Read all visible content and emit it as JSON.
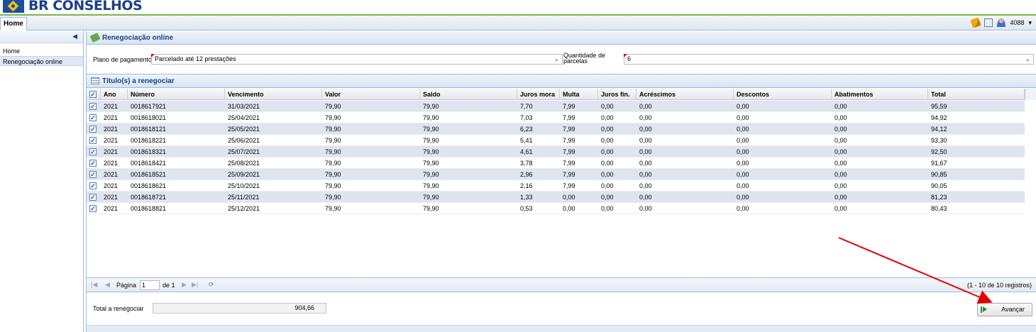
{
  "header": {
    "logo_text": "BR CONSELHOS",
    "tab_home": "Home",
    "user_code": "4088",
    "icons": [
      "pencil-icon",
      "picture-icon",
      "user-icon",
      "chevron-down-icon"
    ]
  },
  "sidebar": {
    "collapse_glyph": "◀",
    "items": [
      {
        "label": "Home"
      },
      {
        "label": "Renegociação online"
      }
    ]
  },
  "panel": {
    "title": "Renegociação online"
  },
  "form": {
    "plan_label": "Plano de pagamento",
    "plan_value": "Parcelado até 12 prestações",
    "qty_label_1": "Quantidade de",
    "qty_label_2": "parcelas",
    "qty_value": "6"
  },
  "grid": {
    "title": "Título(s) a renegociar",
    "columns": [
      "Ano",
      "Número",
      "Vencimento",
      "Valor",
      "Saldo",
      "Juros mora",
      "Multa",
      "Juros fin.",
      "Acréscimos",
      "Descontos",
      "Abatimentos",
      "Total"
    ],
    "rows": [
      {
        "ano": "2021",
        "numero": "0018617921",
        "vencimento": "31/03/2021",
        "valor": "79,90",
        "saldo": "79,90",
        "juros_mora": "7,70",
        "multa": "7,99",
        "juros_fin": "0,00",
        "acrescimos": "0,00",
        "descontos": "0,00",
        "abatimentos": "0,00",
        "total": "95,59"
      },
      {
        "ano": "2021",
        "numero": "0018618021",
        "vencimento": "25/04/2021",
        "valor": "79,90",
        "saldo": "79,90",
        "juros_mora": "7,03",
        "multa": "7,99",
        "juros_fin": "0,00",
        "acrescimos": "0,00",
        "descontos": "0,00",
        "abatimentos": "0,00",
        "total": "94,92"
      },
      {
        "ano": "2021",
        "numero": "0018618121",
        "vencimento": "25/05/2021",
        "valor": "79,90",
        "saldo": "79,90",
        "juros_mora": "6,23",
        "multa": "7,99",
        "juros_fin": "0,00",
        "acrescimos": "0,00",
        "descontos": "0,00",
        "abatimentos": "0,00",
        "total": "94,12"
      },
      {
        "ano": "2021",
        "numero": "0018618221",
        "vencimento": "25/06/2021",
        "valor": "79,90",
        "saldo": "79,90",
        "juros_mora": "5,41",
        "multa": "7,99",
        "juros_fin": "0,00",
        "acrescimos": "0,00",
        "descontos": "0,00",
        "abatimentos": "0,00",
        "total": "93,30"
      },
      {
        "ano": "2021",
        "numero": "0018618321",
        "vencimento": "25/07/2021",
        "valor": "79,90",
        "saldo": "79,90",
        "juros_mora": "4,61",
        "multa": "7,99",
        "juros_fin": "0,00",
        "acrescimos": "0,00",
        "descontos": "0,00",
        "abatimentos": "0,00",
        "total": "92,50"
      },
      {
        "ano": "2021",
        "numero": "0018618421",
        "vencimento": "25/08/2021",
        "valor": "79,90",
        "saldo": "79,90",
        "juros_mora": "3,78",
        "multa": "7,99",
        "juros_fin": "0,00",
        "acrescimos": "0,00",
        "descontos": "0,00",
        "abatimentos": "0,00",
        "total": "91,67"
      },
      {
        "ano": "2021",
        "numero": "0018618521",
        "vencimento": "25/09/2021",
        "valor": "79,90",
        "saldo": "79,90",
        "juros_mora": "2,96",
        "multa": "7,99",
        "juros_fin": "0,00",
        "acrescimos": "0,00",
        "descontos": "0,00",
        "abatimentos": "0,00",
        "total": "90,85"
      },
      {
        "ano": "2021",
        "numero": "0018618621",
        "vencimento": "25/10/2021",
        "valor": "79,90",
        "saldo": "79,90",
        "juros_mora": "2,16",
        "multa": "7,99",
        "juros_fin": "0,00",
        "acrescimos": "0,00",
        "descontos": "0,00",
        "abatimentos": "0,00",
        "total": "90,05"
      },
      {
        "ano": "2021",
        "numero": "0018618721",
        "vencimento": "25/11/2021",
        "valor": "79,90",
        "saldo": "79,90",
        "juros_mora": "1,33",
        "multa": "0,00",
        "juros_fin": "0,00",
        "acrescimos": "0,00",
        "descontos": "0,00",
        "abatimentos": "0,00",
        "total": "81,23"
      },
      {
        "ano": "2021",
        "numero": "0018618821",
        "vencimento": "25/12/2021",
        "valor": "79,90",
        "saldo": "79,90",
        "juros_mora": "0,53",
        "multa": "0,00",
        "juros_fin": "0,00",
        "acrescimos": "0,00",
        "descontos": "0,00",
        "abatimentos": "0,00",
        "total": "80,43"
      }
    ]
  },
  "pager": {
    "page_label": "Página",
    "page_value": "1",
    "of_label": "de 1",
    "info": "(1 - 10 de 10 registros)"
  },
  "footer": {
    "total_label": "Total a renegociar",
    "total_value": "904,66",
    "advance_button": "Avançar"
  },
  "colors": {
    "accent_green": "#7ab648",
    "header_blue": "#15428b",
    "alt_row": "#dfe4ee",
    "annotation_arrow": "#e00000"
  }
}
